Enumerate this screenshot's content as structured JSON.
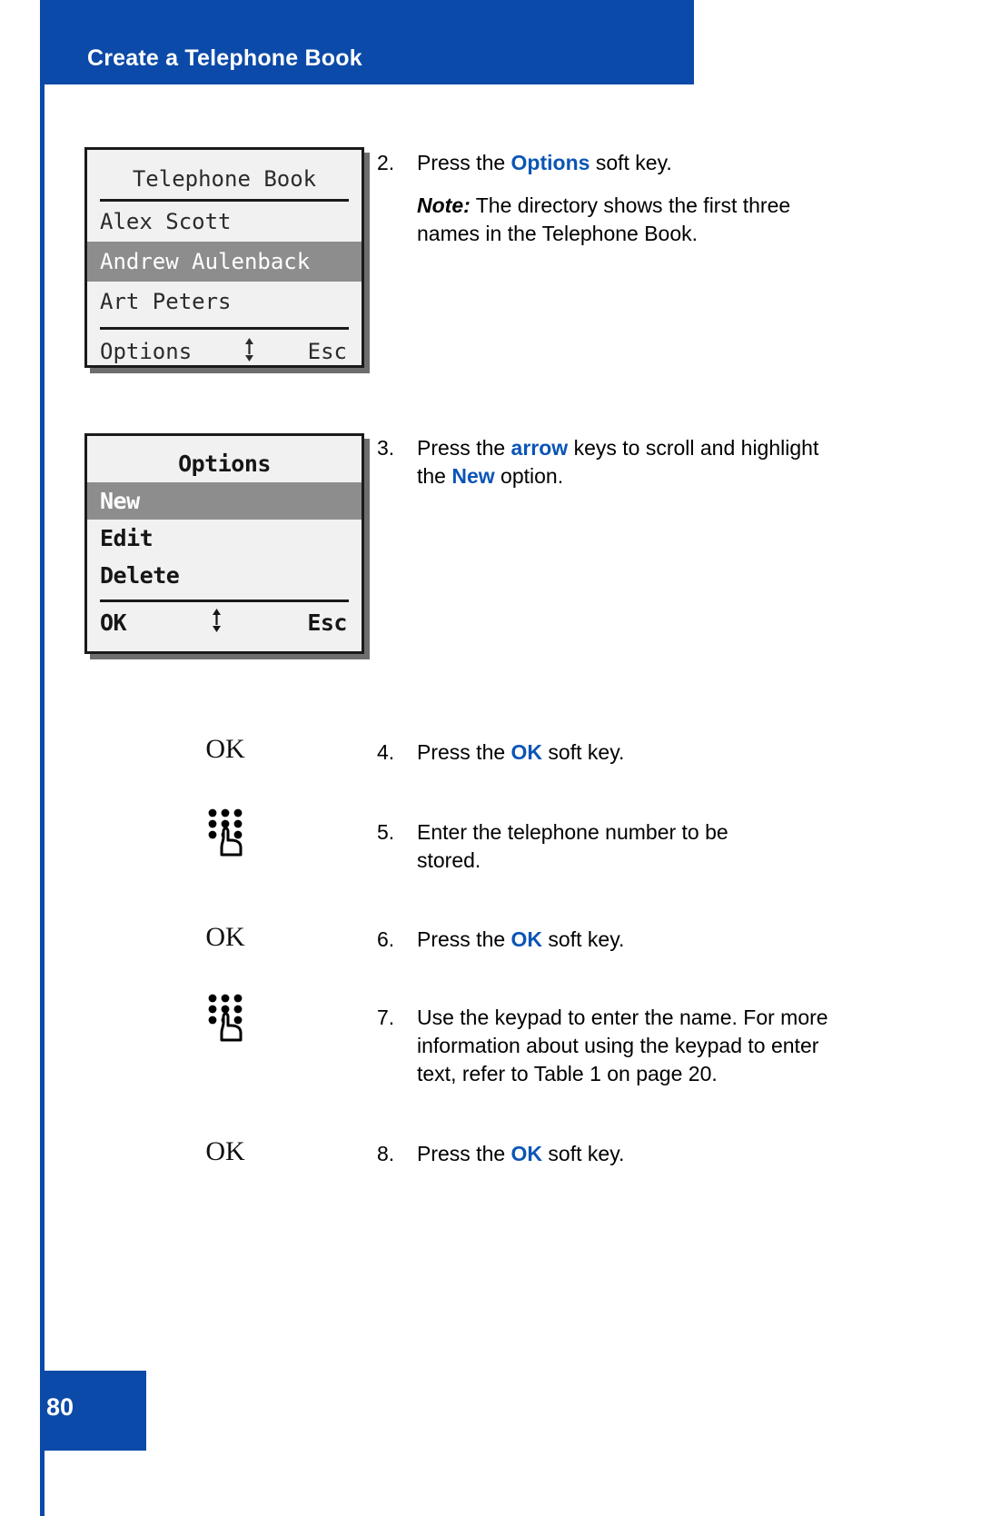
{
  "header": {
    "title": "Create a Telephone Book",
    "bg_color": "#0b4aa8"
  },
  "accent_color": "#0b55b5",
  "screens": [
    {
      "name": "telephone-book",
      "title": "Telephone Book",
      "rows": [
        {
          "label": "Alex Scott",
          "selected": false
        },
        {
          "label": "Andrew Aulenback",
          "selected": true
        },
        {
          "label": "Art Peters",
          "selected": false
        }
      ],
      "softkeys": {
        "left": "Options",
        "center_icon": "up-down-arrow-icon",
        "right": "Esc"
      }
    },
    {
      "name": "options",
      "title": "Options",
      "rows": [
        {
          "label": "New",
          "selected": true
        },
        {
          "label": "Edit",
          "selected": false
        },
        {
          "label": "Delete",
          "selected": false
        }
      ],
      "softkeys": {
        "left": "OK",
        "center_icon": "up-down-arrow-icon",
        "right": "Esc"
      }
    }
  ],
  "steps": [
    {
      "number": "2.",
      "gutter": null,
      "text_parts": [
        {
          "t": "Press the ",
          "style": "plain"
        },
        {
          "t": "Options",
          "style": "accent"
        },
        {
          "t": " soft key.",
          "style": "plain"
        }
      ],
      "note": {
        "label": "Note:",
        "text": " The directory shows the first three names in the Telephone Book."
      }
    },
    {
      "number": "3.",
      "gutter": null,
      "text_parts": [
        {
          "t": "Press the ",
          "style": "plain"
        },
        {
          "t": "arrow",
          "style": "accent"
        },
        {
          "t": " keys to scroll and highlight the ",
          "style": "plain"
        },
        {
          "t": "New",
          "style": "accent"
        },
        {
          "t": " option.",
          "style": "plain"
        }
      ],
      "note": null
    },
    {
      "number": "4.",
      "gutter": "OK",
      "text_parts": [
        {
          "t": "Press the ",
          "style": "plain"
        },
        {
          "t": "OK",
          "style": "accent"
        },
        {
          "t": " soft key.",
          "style": "plain"
        }
      ],
      "note": null
    },
    {
      "number": "5.",
      "gutter": "keypad-icon",
      "text_parts": [
        {
          "t": "Enter the telephone number to be stored.",
          "style": "plain"
        }
      ],
      "note": null
    },
    {
      "number": "6.",
      "gutter": "OK",
      "text_parts": [
        {
          "t": "Press the ",
          "style": "plain"
        },
        {
          "t": "OK",
          "style": "accent"
        },
        {
          "t": " soft key.",
          "style": "plain"
        }
      ],
      "note": null
    },
    {
      "number": "7.",
      "gutter": "keypad-icon",
      "text_parts": [
        {
          "t": "Use the keypad to enter the name. For more information about using the keypad to enter text, refer to Table 1 on page 20.",
          "style": "plain"
        }
      ],
      "note": null
    },
    {
      "number": "8.",
      "gutter": "OK",
      "text_parts": [
        {
          "t": "Press the ",
          "style": "plain"
        },
        {
          "t": "OK",
          "style": "accent"
        },
        {
          "t": " soft key.",
          "style": "plain"
        }
      ],
      "note": null
    }
  ],
  "gutter_labels": {
    "ok": "OK"
  },
  "footer": {
    "page_number": "80",
    "bg_color": "#0b4aa8"
  }
}
